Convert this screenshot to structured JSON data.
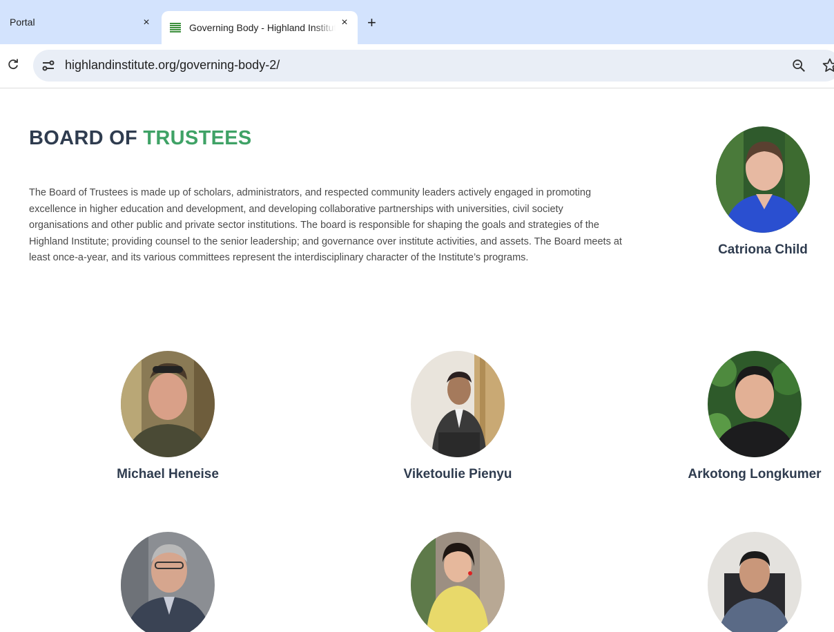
{
  "browser": {
    "tabs": [
      {
        "title": "Portal",
        "active": false
      },
      {
        "title": "Governing Body - Highland Institute",
        "active": true
      }
    ],
    "close_glyph": "×",
    "new_tab_glyph": "+",
    "url": "highlandinstitute.org/governing-body-2/"
  },
  "page": {
    "title_prefix": "BOARD OF ",
    "title_accent": "TRUSTEES",
    "intro": "The Board of Trustees is made up of scholars, administrators, and respected community leaders actively engaged in promoting excellence in higher education and development, and developing collaborative partnerships with universities, civil society organisations and other public and private sector institutions. The board is responsible for shaping the goals and strategies of the Highland Institute; providing counsel to the senior leadership; and governance over institute activities, and assets. The Board meets at least once-a-year, and its various committees represent the interdisciplinary character of the Institute’s programs.",
    "trustees": [
      {
        "name": "Catriona Child"
      },
      {
        "name": "Michael Heneise"
      },
      {
        "name": "Viketoulie Pienyu"
      },
      {
        "name": "Arkotong Longkumer"
      },
      {
        "name": ""
      },
      {
        "name": ""
      },
      {
        "name": ""
      }
    ]
  },
  "colors": {
    "heading": "#2f3c4f",
    "accent": "#3fa266",
    "tabstrip": "#d3e3fd",
    "omnibox": "#e9eef6"
  }
}
